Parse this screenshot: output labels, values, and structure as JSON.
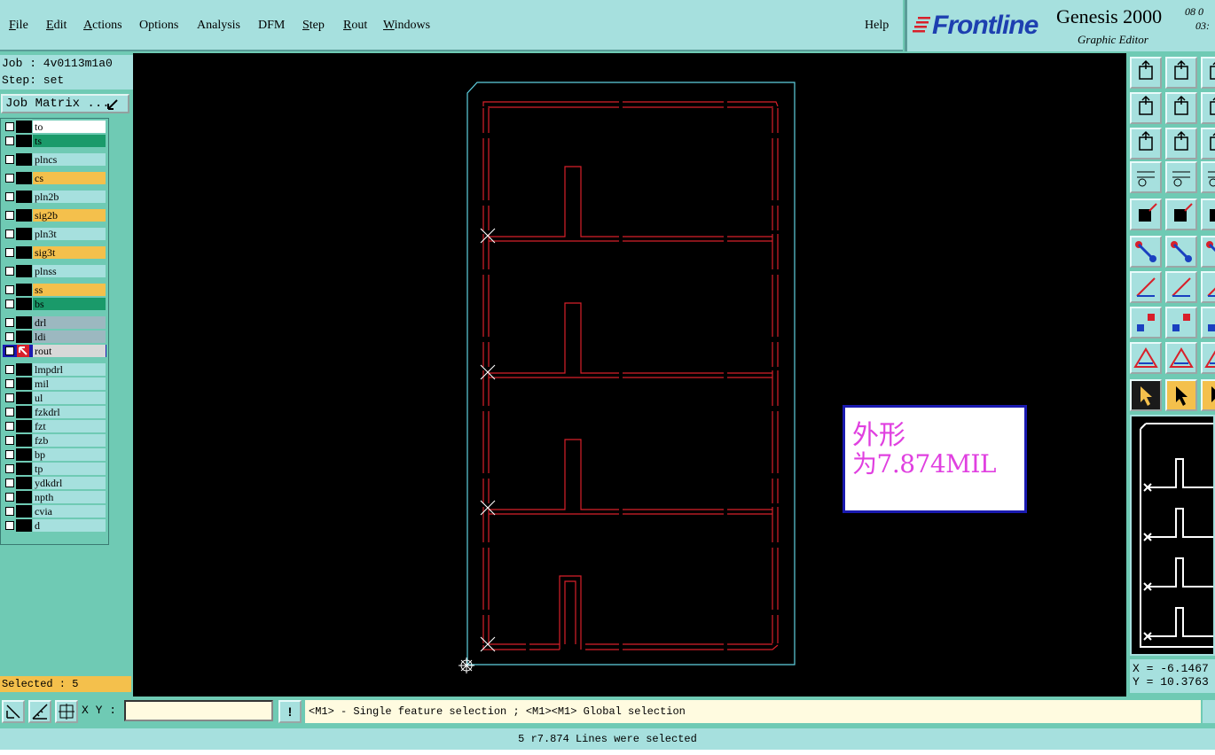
{
  "menu": {
    "file": "File",
    "edit": "Edit",
    "actions": "Actions",
    "options": "Options",
    "analysis": "Analysis",
    "dfm": "DFM",
    "step": "Step",
    "rout": "Rout",
    "windows": "Windows",
    "help": "Help"
  },
  "brand": {
    "logo": "Frontline",
    "product": "Genesis 2000",
    "subtitle": "Graphic Editor",
    "date_line1": "08 0",
    "date_line2": "03:"
  },
  "left": {
    "job": "Job : 4v0113m1a0",
    "step": "Step: set",
    "job_matrix_label": "Job Matrix ..."
  },
  "layers": [
    {
      "name": "to",
      "color": "#ffffff"
    },
    {
      "name": "ts",
      "color": "#1a9a6a"
    },
    {
      "name": "plncs",
      "color": "#a6e0de"
    },
    {
      "name": "cs",
      "color": "#f4c04c"
    },
    {
      "name": "pln2b",
      "color": "#a6e0de"
    },
    {
      "name": "sig2b",
      "color": "#f4c04c"
    },
    {
      "name": "pln3t",
      "color": "#a6e0de"
    },
    {
      "name": "sig3t",
      "color": "#f4c04c"
    },
    {
      "name": "plnss",
      "color": "#a6e0de"
    },
    {
      "name": "ss",
      "color": "#f4c04c"
    },
    {
      "name": "bs",
      "color": "#1a9a6a"
    },
    {
      "name": "drl",
      "color": "#9cb8c0"
    },
    {
      "name": "ldi",
      "color": "#9cb8c0"
    },
    {
      "name": "rout",
      "color": "#d8d8d8"
    },
    {
      "name": "lmpdrl",
      "color": "#a6e0de"
    },
    {
      "name": "mil",
      "color": "#a6e0de"
    },
    {
      "name": "ul",
      "color": "#a6e0de"
    },
    {
      "name": "fzkdrl",
      "color": "#a6e0de"
    },
    {
      "name": "fzt",
      "color": "#a6e0de"
    },
    {
      "name": "fzb",
      "color": "#a6e0de"
    },
    {
      "name": "bp",
      "color": "#a6e0de"
    },
    {
      "name": "tp",
      "color": "#a6e0de"
    },
    {
      "name": "ydkdrl",
      "color": "#a6e0de"
    },
    {
      "name": "npth",
      "color": "#a6e0de"
    },
    {
      "name": "cvia",
      "color": "#a6e0de"
    },
    {
      "name": "d",
      "color": "#a6e0de"
    }
  ],
  "selected_text": "Selected : 5",
  "annotation": {
    "line1": "外形",
    "line2": "为7.874MIL"
  },
  "coords": {
    "x": "X = -6.1467",
    "y": "Y = 10.3763"
  },
  "bottom": {
    "xy_label": "X Y :",
    "xy_value": "",
    "hint": "<M1> - Single feature selection ; <M1><M1> Global selection",
    "status": "5 r7.874 Lines were selected"
  },
  "colors": {
    "rout_lines": "#d8202a",
    "profile": "#5fd0e0",
    "annotation_text": "#e040e0"
  }
}
